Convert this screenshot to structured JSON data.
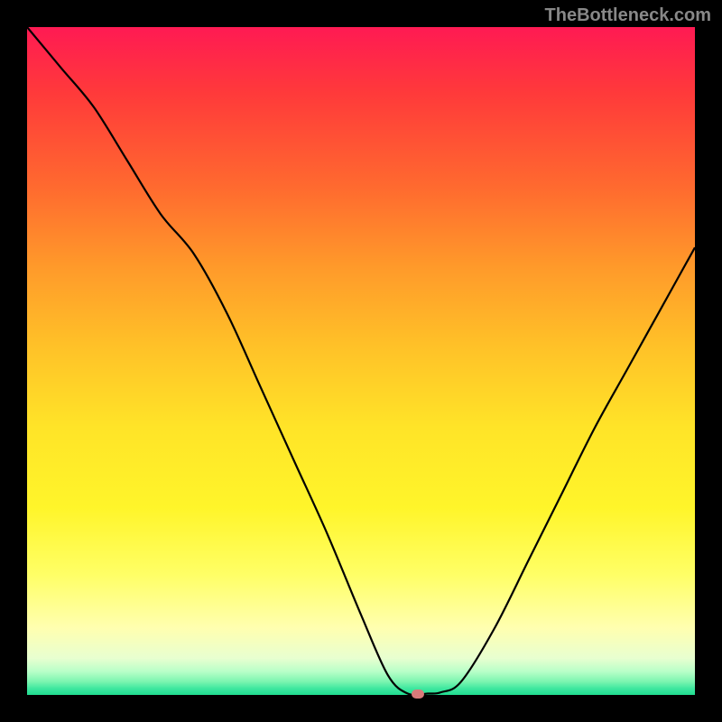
{
  "watermark": "TheBottleneck.com",
  "chart_data": {
    "type": "line",
    "title": "",
    "xlabel": "",
    "ylabel": "",
    "xlim": [
      0,
      100
    ],
    "ylim": [
      0,
      100
    ],
    "x": [
      0,
      5,
      10,
      15,
      20,
      25,
      30,
      35,
      40,
      45,
      50,
      54,
      57,
      60,
      62,
      65,
      70,
      75,
      80,
      85,
      90,
      95,
      100
    ],
    "y": [
      100,
      94,
      88,
      80,
      72,
      66,
      57,
      46,
      35,
      24,
      12,
      3,
      0.2,
      0.2,
      0.4,
      2,
      10,
      20,
      30,
      40,
      49,
      58,
      67
    ],
    "min_marker": {
      "x": 58.5,
      "y": 0.2
    },
    "annotations": []
  }
}
